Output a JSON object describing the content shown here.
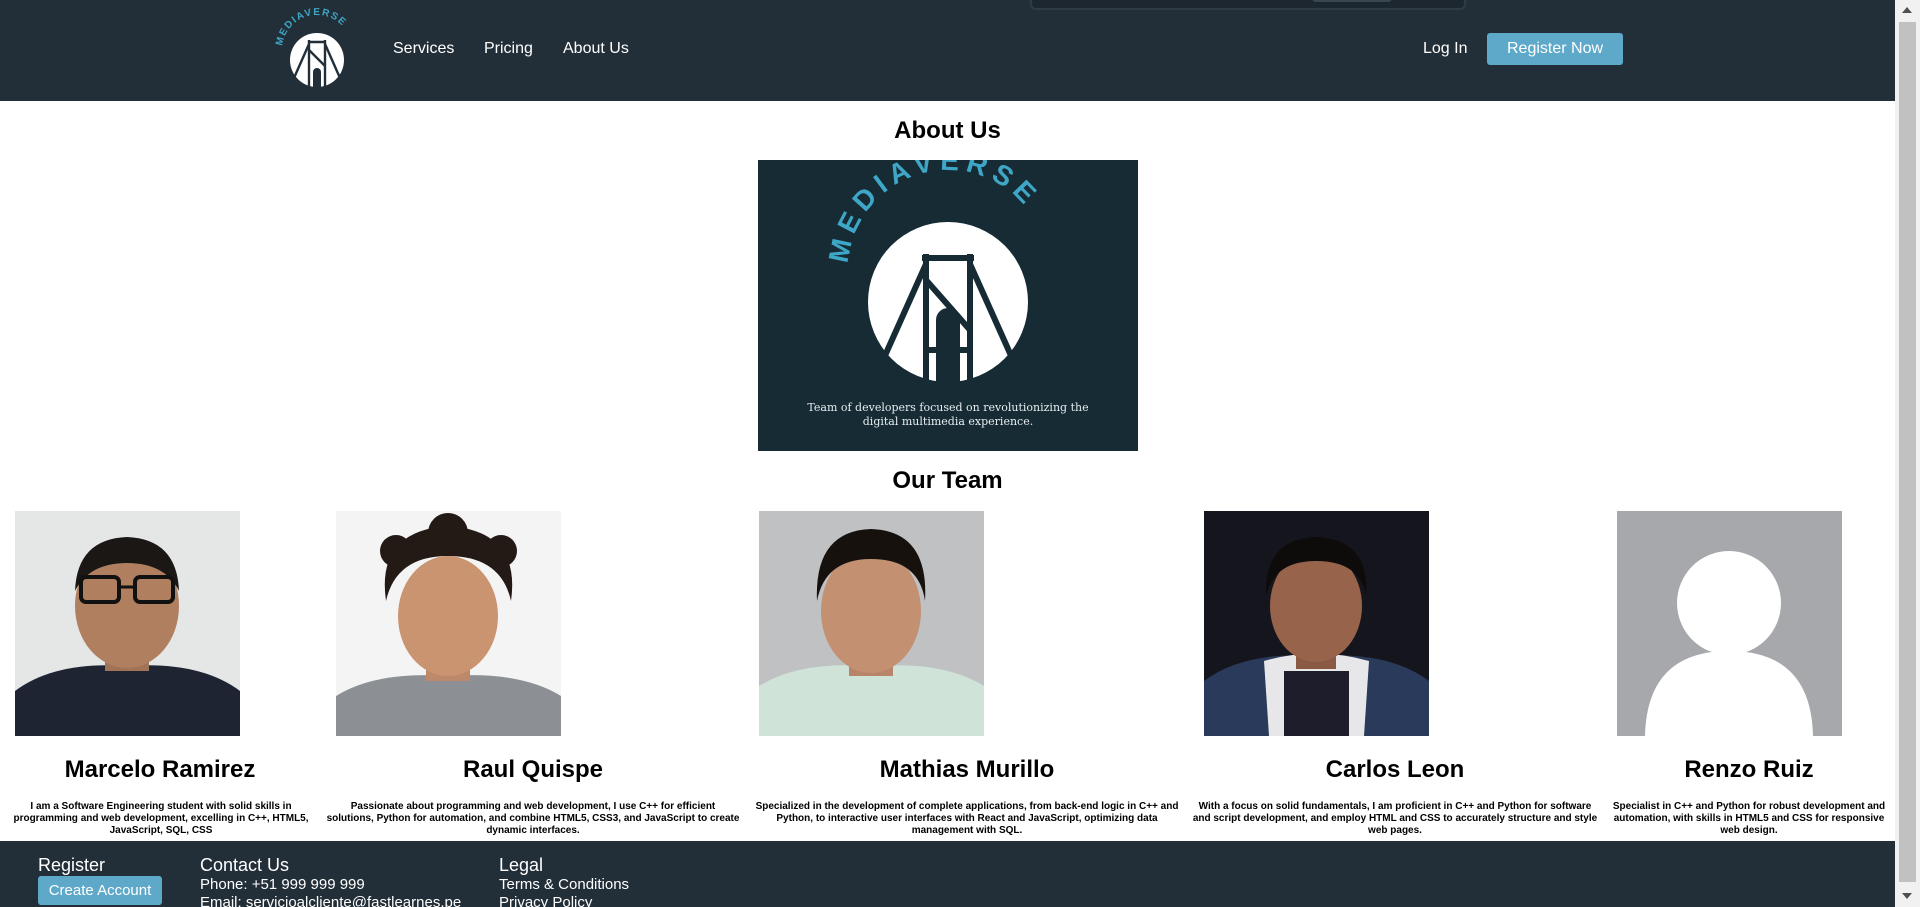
{
  "header": {
    "logo_alt": "MEDIAVERSE",
    "nav": [
      "Services",
      "Pricing",
      "About Us"
    ],
    "login": "Log In",
    "register": "Register Now"
  },
  "about": {
    "title": "About Us",
    "banner_brand": "MEDIAVERSE",
    "banner_caption": "Team of developers focused on revolutionizing the digital multimedia experience."
  },
  "team": {
    "title": "Our Team",
    "members": [
      {
        "name": "Marcelo Ramirez",
        "bio": "I am a Software Engineering student with solid skills in programming and web development, excelling in C++, HTML5, JavaScript, SQL, CSS"
      },
      {
        "name": "Raul Quispe",
        "bio": "Passionate about programming and web development, I use C++ for efficient solutions, Python for automation, and combine HTML5, CSS3, and JavaScript to create dynamic interfaces."
      },
      {
        "name": "Mathias Murillo",
        "bio": "Specialized in the development of complete applications, from back-end logic in C++ and Python, to interactive user interfaces with React and JavaScript, optimizing data management with SQL."
      },
      {
        "name": "Carlos Leon",
        "bio": "With a focus on solid fundamentals, I am proficient in C++ and Python for software and script development, and employ HTML and CSS to accurately structure and style web pages."
      },
      {
        "name": "Renzo Ruiz",
        "bio": "Specialist in C++ and Python for robust development and automation, with skills in HTML5 and CSS for responsive web design."
      }
    ]
  },
  "footer": {
    "register_heading": "Register",
    "create_account": "Create Account",
    "contact_heading": "Contact Us",
    "phone": "Phone: +51 999 999 999",
    "email": "Email: servicioalcliente@fastlearnes.pe",
    "legal_heading": "Legal",
    "terms": "Terms & Conditions",
    "privacy": "Privacy Policy"
  },
  "colors": {
    "header_bg": "#232f38",
    "accent": "#5ea8c9",
    "banner_bg": "#172b35"
  }
}
